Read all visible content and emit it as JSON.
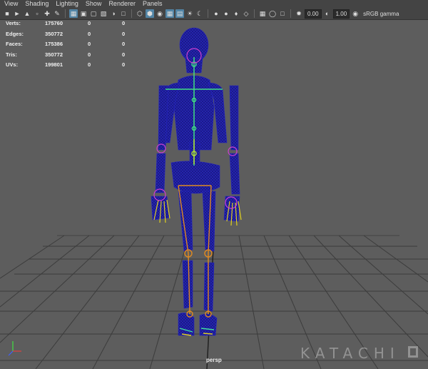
{
  "menu": [
    "View",
    "Shading",
    "Lighting",
    "Show",
    "Renderer",
    "Panels"
  ],
  "toolbar": {
    "exposure": "0.00",
    "gamma": "1.00",
    "color_space": "sRGB gamma"
  },
  "hud": {
    "rows": [
      {
        "label": "Verts:",
        "value": "175760",
        "sel": "0",
        "comp": "0"
      },
      {
        "label": "Edges:",
        "value": "350772",
        "sel": "0",
        "comp": "0"
      },
      {
        "label": "Faces:",
        "value": "175386",
        "sel": "0",
        "comp": "0"
      },
      {
        "label": "Tris:",
        "value": "350772",
        "sel": "0",
        "comp": "0"
      },
      {
        "label": "UVs:",
        "value": "199801",
        "sel": "0",
        "comp": "0"
      }
    ]
  },
  "camera_label": "persp",
  "watermark": "KATACHI",
  "colors": {
    "viewport_bg": "#5d5d5d",
    "mesh": "#1a1aa0",
    "joints_spine": "#40e080",
    "joints_legs": "#e08a20",
    "joints_hands": "#e0d020",
    "selection": "#d040d0"
  }
}
